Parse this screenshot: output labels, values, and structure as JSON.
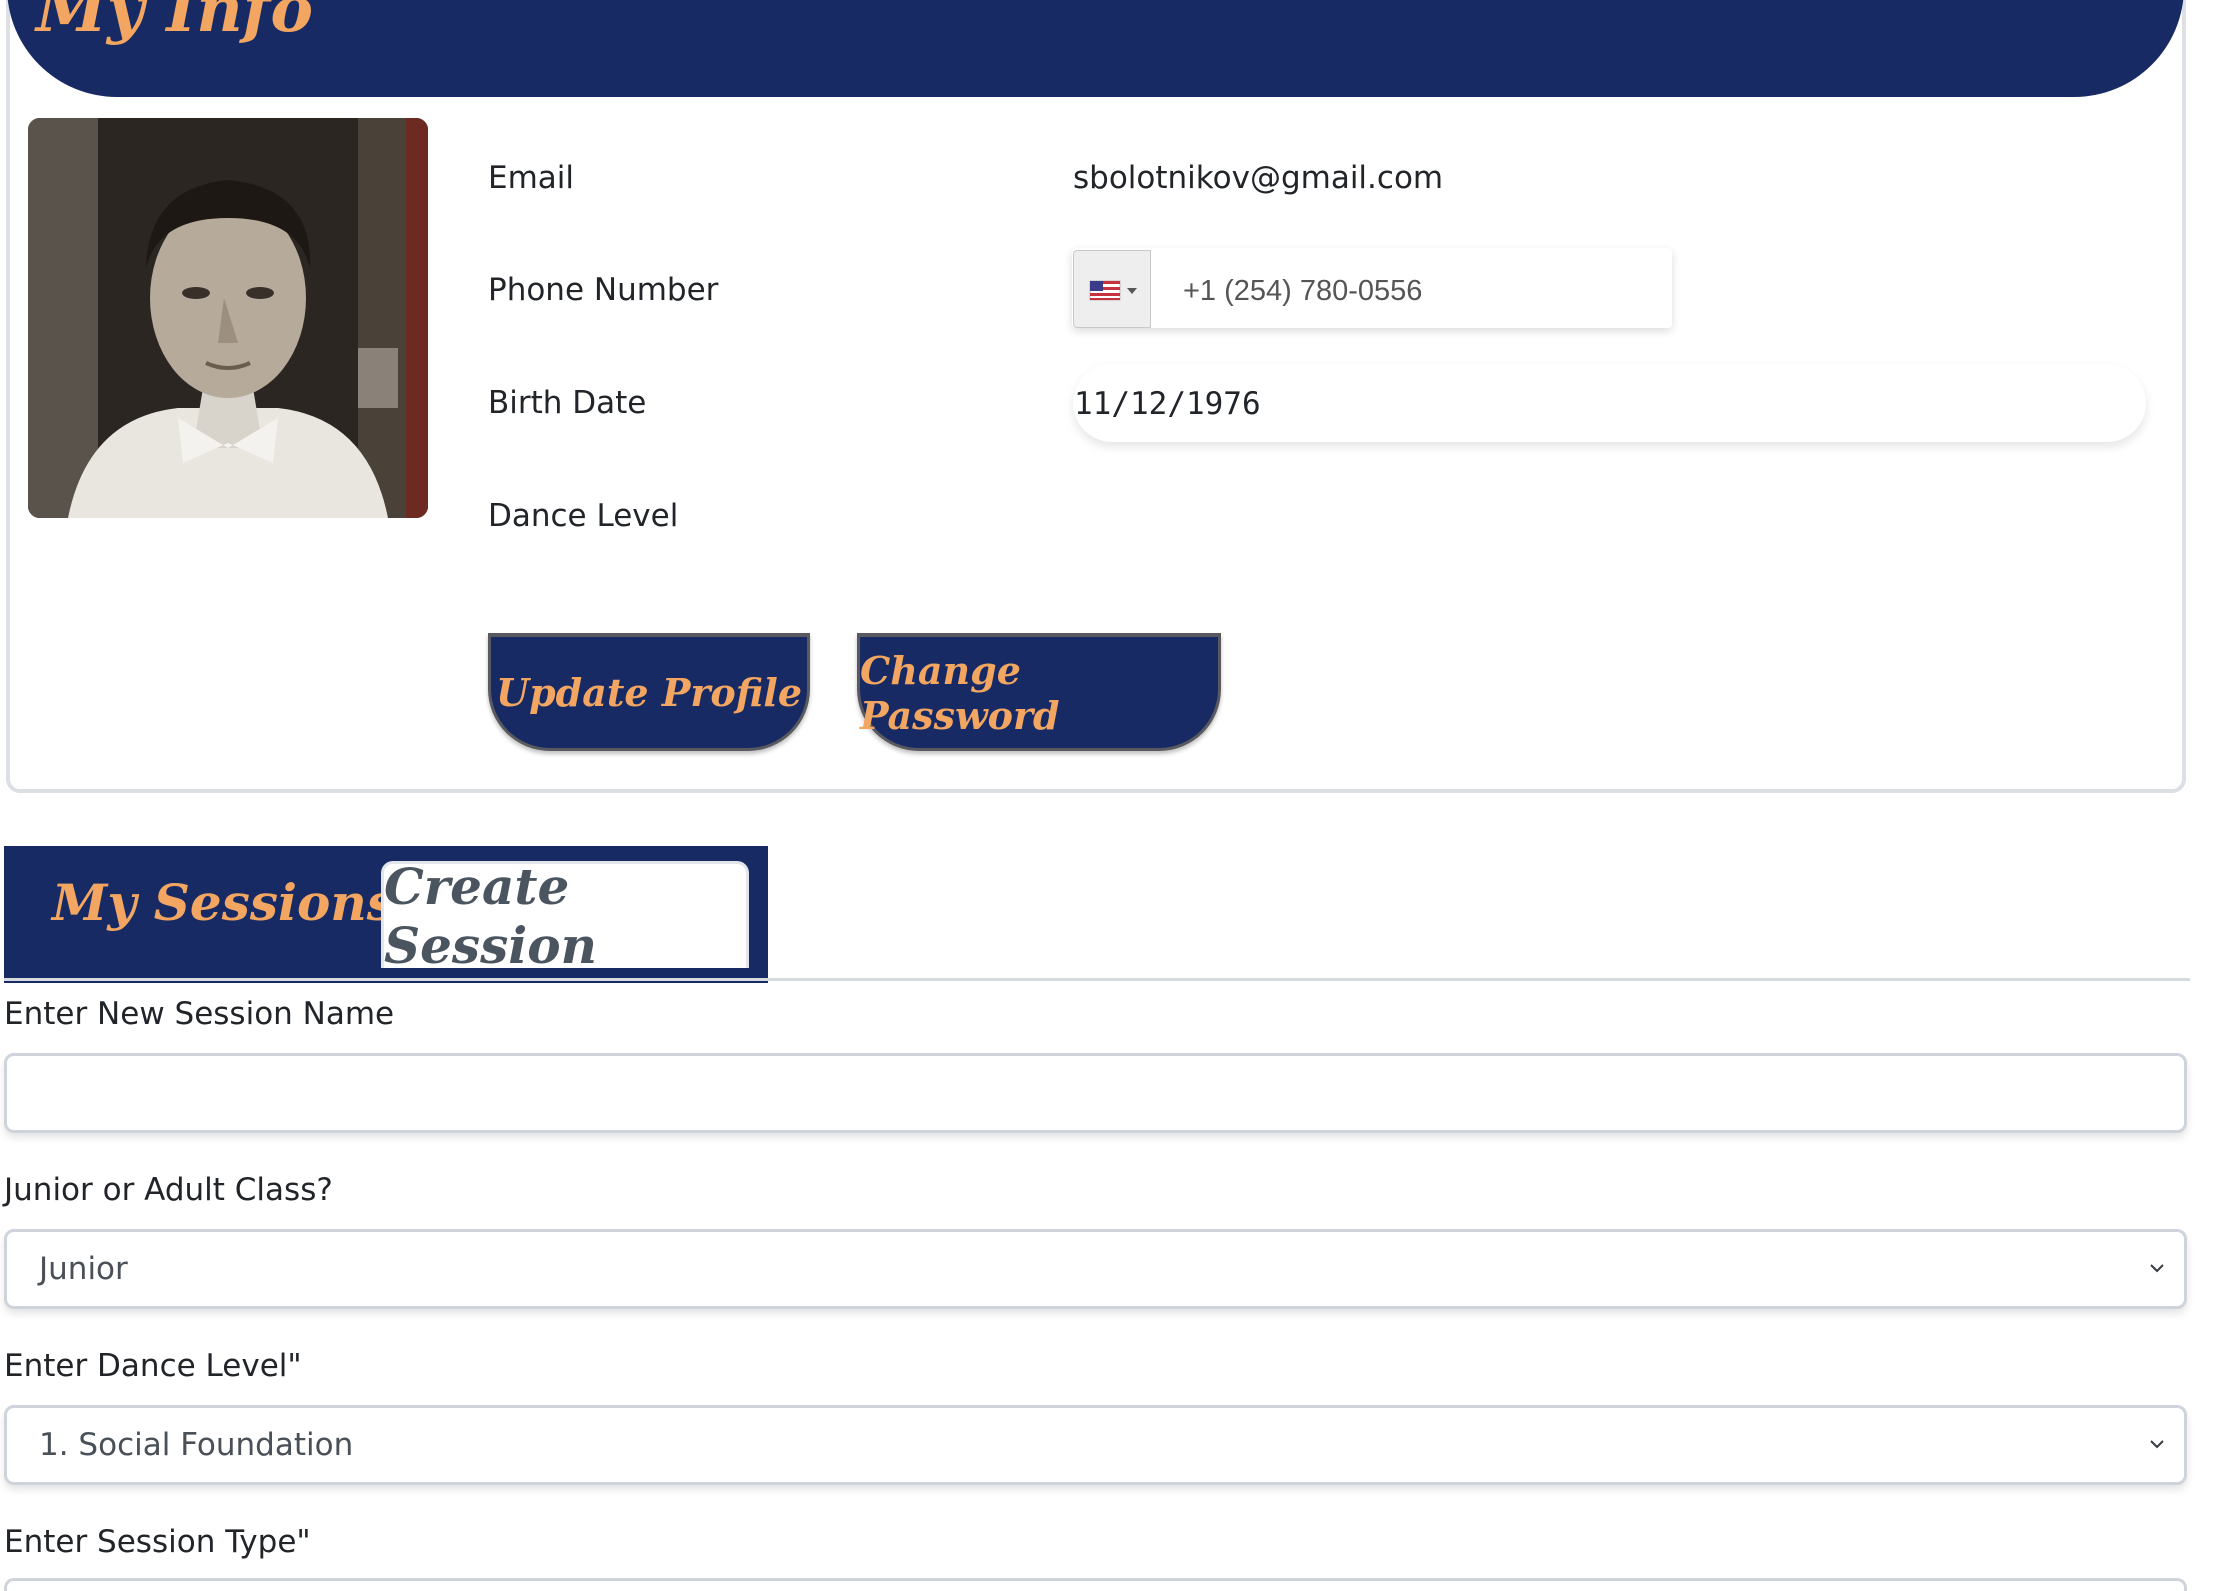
{
  "info": {
    "title": "My Info",
    "email_label": "Email",
    "email_value": "sbolotnikov@gmail.com",
    "phone_label": "Phone Number",
    "phone_value": "+1 (254) 780-0556",
    "birth_label": "Birth Date",
    "birth_value": "11/12/1976",
    "dance_label": "Dance Level",
    "dance_value": "",
    "update_button": "Update Profile",
    "password_button": "Change Password"
  },
  "tabs": {
    "my_sessions": "My Sessions",
    "create_session": "Create Session"
  },
  "form": {
    "session_name_label": "Enter New Session Name",
    "session_name_value": "",
    "class_label": "Junior or Adult Class?",
    "class_value": "Junior",
    "level_label": "Enter Dance Level\"",
    "level_value": "1. Social Foundation",
    "type_label": "Enter Session Type\""
  },
  "colors": {
    "navy": "#172a64",
    "accent_orange": "#f2a661"
  },
  "icons": {
    "flag": "us-flag-icon",
    "dropdown": "chevron-down-icon"
  }
}
